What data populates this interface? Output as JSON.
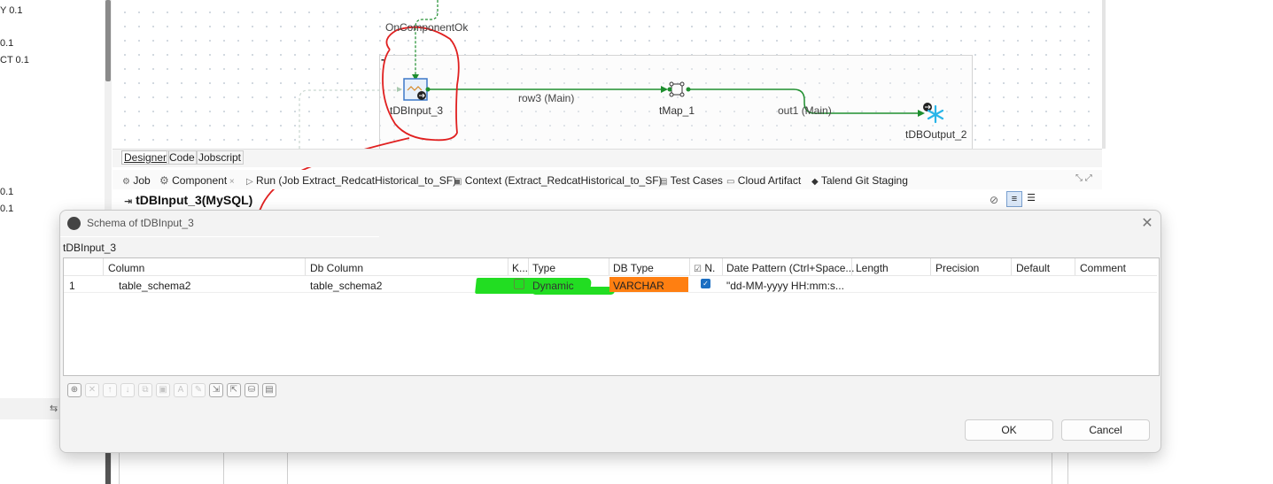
{
  "left_panel": {
    "items": [
      "Y 0.1",
      "0.1",
      "CT 0.1",
      "0.1",
      "0.1"
    ]
  },
  "canvas": {
    "link_on_component_ok": "OnComponentOk",
    "components": [
      {
        "label": "tDBInput_3"
      },
      {
        "label": "tMap_1"
      },
      {
        "label": "tDBOutput_2"
      }
    ],
    "links": [
      {
        "label": "row3 (Main)"
      },
      {
        "label": "out1 (Main)"
      }
    ]
  },
  "editor_tabs": [
    "Designer",
    "Code",
    "Jobscript"
  ],
  "view_tabs": [
    {
      "label": "Job",
      "icon": "job-icon"
    },
    {
      "label": "Component",
      "icon": "component-icon"
    },
    {
      "label": "Run (Job Extract_RedcatHistorical_to_SF)",
      "icon": "run-icon"
    },
    {
      "label": "Context (Extract_RedcatHistorical_to_SF)",
      "icon": "context-icon"
    },
    {
      "label": "Test Cases",
      "icon": "test-cases-icon"
    },
    {
      "label": "Cloud Artifact",
      "icon": "cloud-artifact-icon"
    },
    {
      "label": "Talend Git Staging",
      "icon": "git-staging-icon"
    }
  ],
  "component_title": "tDBInput_3(MySQL)",
  "dialog": {
    "title": "Schema of tDBInput_3",
    "subtitle": "tDBInput_3",
    "columns": [
      "Column",
      "Db Column",
      "K...",
      "Type",
      "DB Type",
      "N.",
      "Date Pattern (Ctrl+Space...",
      "Length",
      "Precision",
      "Default",
      "Comment"
    ],
    "rows": [
      {
        "index": "1",
        "column": "table_schema2",
        "db_column": "table_schema2",
        "key": false,
        "type": "Dynamic",
        "db_type": "VARCHAR",
        "nullable": true,
        "date_pattern": "\"dd-MM-yyyy HH:mm:s...",
        "length": "",
        "precision": "",
        "default": "",
        "comment": ""
      }
    ],
    "ok_label": "OK",
    "cancel_label": "Cancel"
  },
  "colors": {
    "highlight_type": "#22dd22",
    "highlight_db_type": "#ff7f11",
    "annotation_red": "#e02020",
    "link_green": "#1e8e2e"
  }
}
